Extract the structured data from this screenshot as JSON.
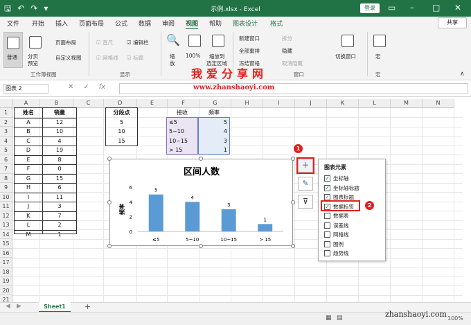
{
  "title": "示例.xlsx - Excel",
  "login_label": "登录",
  "share_label": "共享",
  "tabs": [
    "文件",
    "开始",
    "插入",
    "页面布局",
    "公式",
    "数据",
    "审阅",
    "视图",
    "帮助",
    "图表设计",
    "格式"
  ],
  "ribbon": {
    "normal": "普通",
    "page_break": "分页",
    "page_break2": "预览",
    "page_layout": "页面布局",
    "custom_view": "自定义视图",
    "ruler": "直尺",
    "formula_bar": "编辑栏",
    "gridlines": "网格线",
    "headings": "标题",
    "zoom": "缩",
    "zoom2": "放",
    "zoom100": "100%",
    "zoom_sel": "缩放到",
    "zoom_sel2": "选定区域",
    "new_window": "新建窗口",
    "arrange_all": "全部重排",
    "freeze": "冻结窗格",
    "split": "拆分",
    "hide": "隐藏",
    "unhide": "取消隐藏",
    "switch_windows": "切换窗口",
    "macros": "宏",
    "macros2": "宏",
    "group_views": "工作簿视图",
    "group_show": "显示",
    "group_window": "窗口"
  },
  "watermark": {
    "line1": "我爱分享网",
    "line2": "www.zhanshaoyi.com",
    "line3": "zhanshaoyi.com"
  },
  "namebox": "图表 2",
  "fx": "fx",
  "columns": [
    "A",
    "B",
    "C",
    "D",
    "E",
    "F",
    "G",
    "H",
    "I",
    "J",
    "K",
    "L",
    "M",
    "N"
  ],
  "rows": [
    "1",
    "2",
    "3",
    "4",
    "5",
    "6",
    "7",
    "8",
    "9",
    "10",
    "11",
    "12",
    "13",
    "14",
    "15",
    "16",
    "17",
    "18",
    "19",
    "20",
    "21"
  ],
  "table1": {
    "header": [
      "姓名",
      "销量"
    ],
    "rows": [
      [
        "A",
        "12"
      ],
      [
        "B",
        "10"
      ],
      [
        "C",
        "4"
      ],
      [
        "D",
        "19"
      ],
      [
        "E",
        "8"
      ],
      [
        "F",
        "0"
      ],
      [
        "G",
        "15"
      ],
      [
        "H",
        "6"
      ],
      [
        "I",
        "11"
      ],
      [
        "J",
        "3"
      ],
      [
        "K",
        "7"
      ],
      [
        "L",
        "2"
      ],
      [
        "M",
        "1"
      ]
    ]
  },
  "table2": {
    "header": "分段点",
    "values": [
      "5",
      "10",
      "15"
    ]
  },
  "table3": {
    "header": [
      "接收",
      "频率"
    ],
    "rows": [
      [
        "≤5",
        "5"
      ],
      [
        "5~10",
        "4"
      ],
      [
        "10~15",
        "3"
      ],
      [
        "> 15",
        "1"
      ]
    ]
  },
  "chart_data": {
    "type": "bar",
    "title": "区间人数",
    "ylabel": "频率",
    "categories": [
      "≤5",
      "5~10",
      "10~15",
      "> 15"
    ],
    "values": [
      5,
      4,
      3,
      1
    ],
    "ylim": [
      0,
      6
    ],
    "yticks": [
      "0",
      "2",
      "4",
      "6"
    ],
    "color": "#5b9bd5"
  },
  "panel": {
    "title": "图表元素",
    "items": [
      {
        "label": "坐标轴",
        "checked": "✓"
      },
      {
        "label": "坐标轴标题",
        "checked": "✓"
      },
      {
        "label": "图表标题",
        "checked": "✓"
      },
      {
        "label": "数据标签",
        "checked": "✓"
      },
      {
        "label": "数据表",
        "checked": ""
      },
      {
        "label": "误差线",
        "checked": ""
      },
      {
        "label": "网格线",
        "checked": ""
      },
      {
        "label": "图例",
        "checked": ""
      },
      {
        "label": "趋势线",
        "checked": ""
      }
    ]
  },
  "badges": [
    "1",
    "2"
  ],
  "sheet_tab": "Sheet1",
  "add_sheet": "+",
  "zoom_level": "100%",
  "accent": "#217346"
}
